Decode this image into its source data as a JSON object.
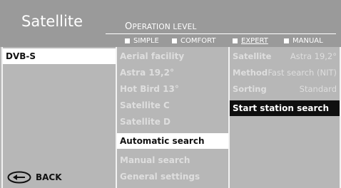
{
  "header": {
    "title": "Satellite",
    "operation_level_title_cap": "O",
    "operation_level_title_rest": "PERATION LEVEL",
    "options": [
      {
        "label": "SIMPLE",
        "selected": false
      },
      {
        "label": "COMFORT",
        "selected": false
      },
      {
        "label": "EXPERT",
        "selected": true
      },
      {
        "label": "MANUAL",
        "selected": false
      }
    ]
  },
  "col1": {
    "items": [
      "DVB-S"
    ]
  },
  "col2": {
    "items": [
      "Aerial facility",
      "Astra 19,2°",
      "Hot Bird 13°",
      "Satellite C",
      "Satellite D",
      "Automatic search",
      "Manual search",
      "General settings"
    ],
    "selected_index": 5
  },
  "col3": {
    "rows": [
      {
        "label": "Satellite",
        "value": "Astra 19,2°"
      },
      {
        "label": "Method",
        "value": "Fast search (NIT)"
      },
      {
        "label": "Sorting",
        "value": "Standard"
      }
    ],
    "action_label": "Start station search"
  },
  "footer": {
    "back_label": "BACK",
    "back_icon": "back-arrow-icon"
  },
  "colors": {
    "selected_white": "#ffffff",
    "selected_black": "#0f0f0f",
    "background": "#b7b7b7",
    "text_dim": "#dedede"
  }
}
